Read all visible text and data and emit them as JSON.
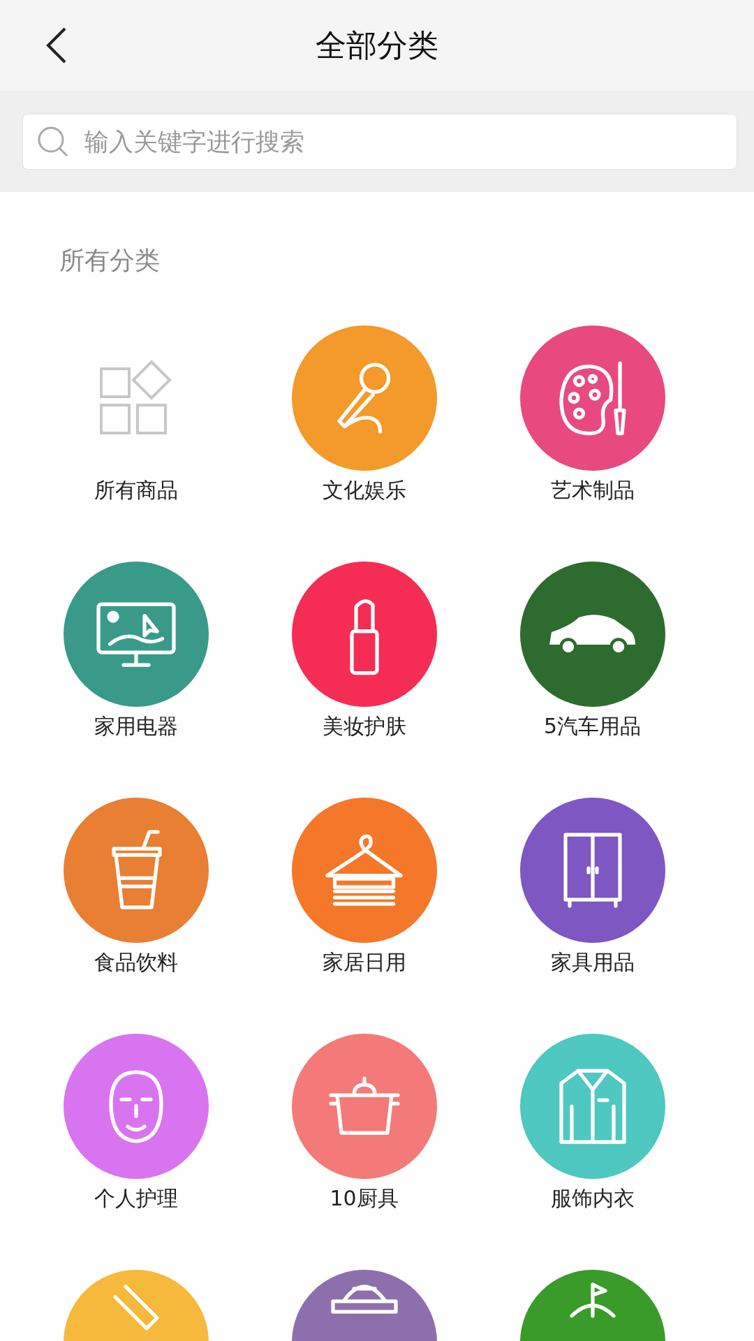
{
  "header": {
    "title": "全部分类"
  },
  "search": {
    "placeholder": "输入关键字进行搜索"
  },
  "section_title": "所有分类",
  "categories": [
    {
      "kind": "all",
      "label": "所有商品"
    },
    {
      "kind": "circle",
      "label": "文化娱乐",
      "color": "#f39a2b"
    },
    {
      "kind": "circle",
      "label": "艺术制品",
      "color": "#e84a7f"
    },
    {
      "kind": "circle",
      "label": "家用电器",
      "color": "#3a9a8a"
    },
    {
      "kind": "circle",
      "label": "美妆护肤",
      "color": "#f52d55"
    },
    {
      "kind": "circle",
      "label": "5汽车用品",
      "color": "#2e6b2e"
    },
    {
      "kind": "circle",
      "label": "食品饮料",
      "color": "#e87f33"
    },
    {
      "kind": "circle",
      "label": "家居日用",
      "color": "#f5772a"
    },
    {
      "kind": "circle",
      "label": "家具用品",
      "color": "#7e57c2"
    },
    {
      "kind": "circle",
      "label": "个人护理",
      "color": "#d974f0"
    },
    {
      "kind": "circle",
      "label": "10厨具",
      "color": "#f47a7a"
    },
    {
      "kind": "circle",
      "label": "服饰内衣",
      "color": "#4ec8c0"
    },
    {
      "kind": "circle",
      "color": "#f6b93b"
    },
    {
      "kind": "circle",
      "color": "#8e6fae"
    },
    {
      "kind": "circle",
      "color": "#3a9a2a"
    }
  ]
}
